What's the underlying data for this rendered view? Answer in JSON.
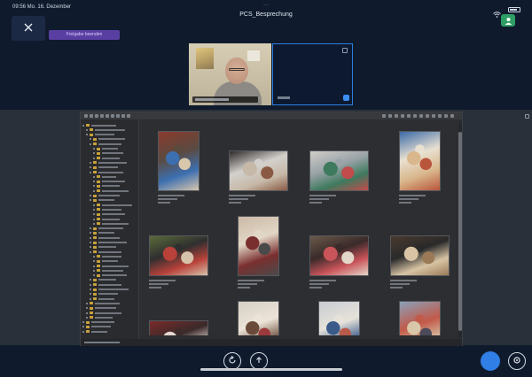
{
  "status_bar": {
    "datetime": "09:56  Mo. 16. Dezember",
    "wifi_icon": "wifi-icon",
    "battery_icon": "battery-icon"
  },
  "meeting": {
    "indicator": "···",
    "title": "PCS_Besprechung"
  },
  "top_controls": {
    "close_icon": "close-icon",
    "stop_share_label": "Freigabe beenden",
    "avatar_icon": "avatar-icon"
  },
  "bottom_controls": {
    "left_icons": [
      "rotate-icon",
      "share-icon"
    ],
    "right_icons": [
      "chat-icon",
      "more-icon"
    ]
  },
  "colors": {
    "background": "#0f1b2d",
    "accent_blue": "#2f7fe6",
    "share_purple": "#5a3fa3",
    "avatar_green": "#2f9e64",
    "folder_yellow": "#c9a23a"
  },
  "photos": [
    {
      "orientation": "portrait",
      "colors": [
        "#8a3b2e",
        "#3c6fb0",
        "#d8c6ad",
        "#5b4a40"
      ]
    },
    {
      "orientation": "landscape",
      "colors": [
        "#2e2a2a",
        "#c7b9a8",
        "#8a5a44",
        "#d3d0cc"
      ]
    },
    {
      "orientation": "landscape",
      "colors": [
        "#cfcdc8",
        "#3e7a5e",
        "#c24b4b",
        "#9aa3a8"
      ]
    },
    {
      "orientation": "portrait",
      "colors": [
        "#3b6aa8",
        "#d9b68c",
        "#b9553a",
        "#e8e0d0"
      ]
    },
    {
      "orientation": "landscape",
      "colors": [
        "#5b6b3a",
        "#b8413a",
        "#d6c2aa",
        "#2f2f2f"
      ]
    },
    {
      "orientation": "portrait",
      "colors": [
        "#cbb9a6",
        "#7a2f2f",
        "#4a4a4a",
        "#e2d6c6"
      ]
    },
    {
      "orientation": "landscape",
      "colors": [
        "#6b5a4a",
        "#c9545a",
        "#e3d7c9",
        "#3a2a2a"
      ]
    },
    {
      "orientation": "landscape",
      "colors": [
        "#4a3a2e",
        "#d8c4a4",
        "#9a7a56",
        "#2a2a2a"
      ]
    },
    {
      "orientation": "landscape",
      "colors": [
        "#7a2a2a",
        "#e6d6d0",
        "#b03040",
        "#3a2a2a"
      ]
    },
    {
      "orientation": "portrait",
      "colors": [
        "#d6cfc4",
        "#6a4a3a",
        "#9a3a3a",
        "#ece4d8"
      ]
    },
    {
      "orientation": "portrait",
      "colors": [
        "#c8ccd2",
        "#3a5a8a",
        "#b85a4a",
        "#e6e2da"
      ]
    },
    {
      "orientation": "portrait",
      "colors": [
        "#8aa0b8",
        "#d8c7a8",
        "#4a4a5a",
        "#c25a4a"
      ]
    }
  ]
}
